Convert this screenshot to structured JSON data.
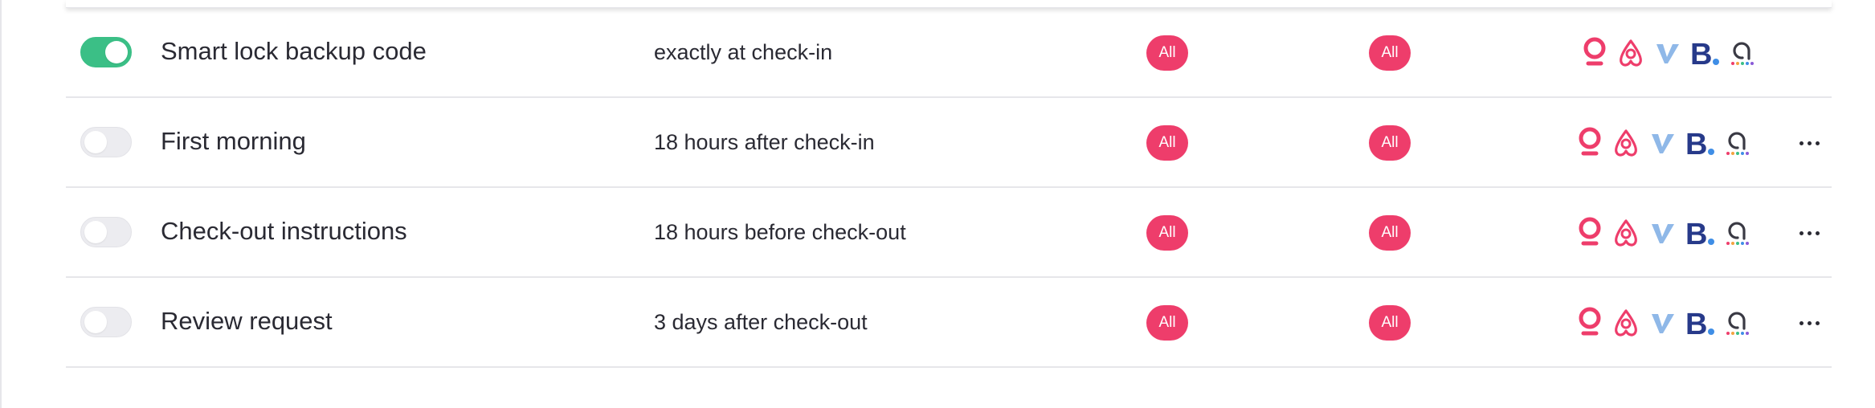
{
  "colors": {
    "toggle_on": "#3bbf86",
    "toggle_off": "#ececf0",
    "pill": "#ee3d6b",
    "booking_blue": "#273a8a",
    "vrbo_blue": "#8fb8e8"
  },
  "rows": [
    {
      "name": "Smart lock backup code",
      "timing": "exactly at check-in",
      "enabled": true,
      "pill_a": "All",
      "pill_b": "All",
      "has_more": false
    },
    {
      "name": "First morning",
      "timing": "18 hours after check-in",
      "enabled": false,
      "pill_a": "All",
      "pill_b": "All",
      "has_more": true
    },
    {
      "name": "Check-out instructions",
      "timing": "18 hours before check-out",
      "enabled": false,
      "pill_a": "All",
      "pill_b": "All",
      "has_more": true
    },
    {
      "name": "Review request",
      "timing": "3 days after check-out",
      "enabled": false,
      "pill_a": "All",
      "pill_b": "All",
      "has_more": true
    }
  ],
  "channel_icons": [
    "location-pin-icon",
    "airbnb-icon",
    "vrbo-icon",
    "booking-com-icon",
    "channel-dots-icon"
  ]
}
